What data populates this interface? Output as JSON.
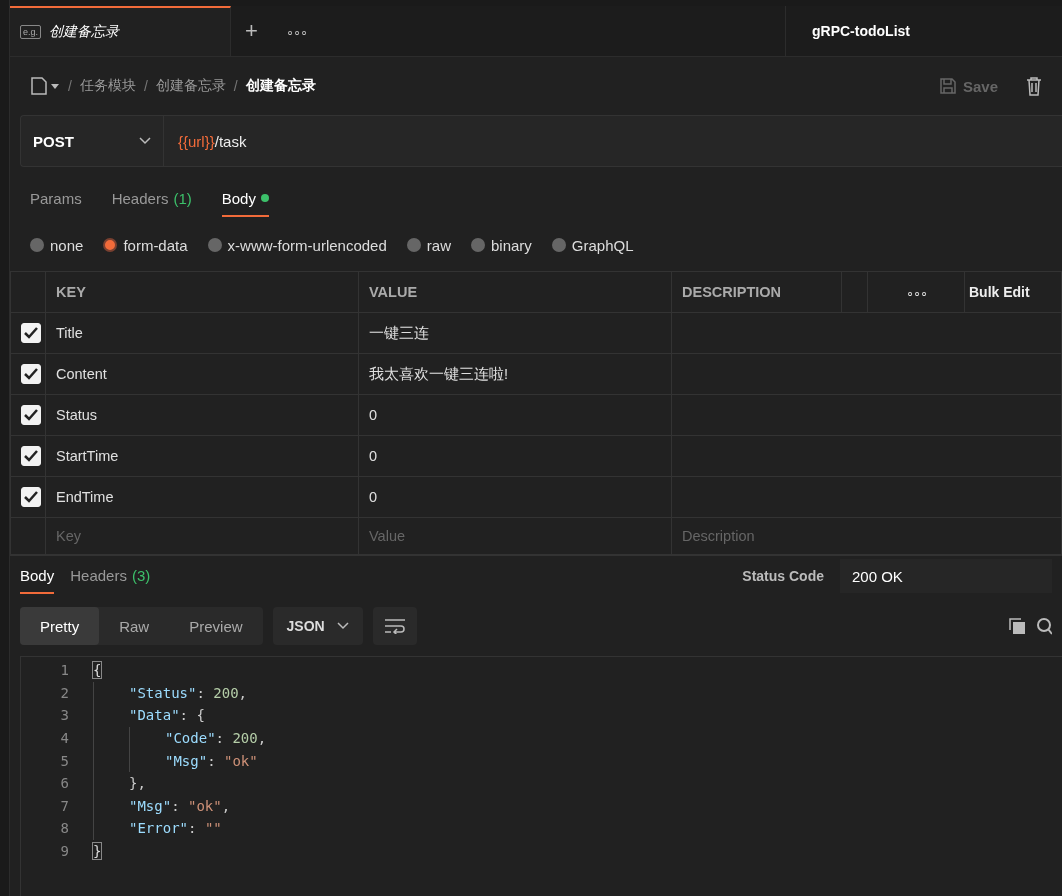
{
  "tabs": [
    {
      "badge": "e.g.",
      "label": "创建备忘录",
      "selected": true
    }
  ],
  "new_tab": "+",
  "more_tabs": "∘∘∘",
  "environment": "gRPC-todoList",
  "breadcrumb": [
    {
      "separator": "/",
      "label": "任务模块"
    },
    {
      "separator": "/",
      "label": "创建备忘录"
    },
    {
      "separator": "/",
      "label": "创建备忘录"
    }
  ],
  "save": {
    "label": "Save",
    "disabled": true
  },
  "request": {
    "method": "POST",
    "url_variable": "{{url}}",
    "url_path": "/task"
  },
  "request_tabs": [
    {
      "label": "Params",
      "selected": false
    },
    {
      "label": "Headers",
      "count": "(1)",
      "selected": false
    },
    {
      "label": "Body",
      "dot": true,
      "selected": true
    }
  ],
  "body_types": [
    {
      "label": "none",
      "selected": false
    },
    {
      "label": "form-data",
      "selected": true
    },
    {
      "label": "x-www-form-urlencoded",
      "selected": false
    },
    {
      "label": "raw",
      "selected": false
    },
    {
      "label": "binary",
      "selected": false
    },
    {
      "label": "GraphQL",
      "selected": false
    }
  ],
  "table": {
    "columns": [
      "KEY",
      "VALUE",
      "DESCRIPTION"
    ],
    "more": "∘∘∘",
    "bulk_edit": "Bulk Edit",
    "rows": [
      {
        "checked": true,
        "key": "Title",
        "value": "一键三连"
      },
      {
        "checked": true,
        "key": "Content",
        "value": "我太喜欢一键三连啦!"
      },
      {
        "checked": true,
        "key": "Status",
        "value": "0"
      },
      {
        "checked": true,
        "key": "StartTime",
        "value": "0"
      },
      {
        "checked": true,
        "key": "EndTime",
        "value": "0"
      }
    ],
    "new_row": {
      "key_placeholder": "Key",
      "value_placeholder": "Value",
      "description_placeholder": "Description"
    }
  },
  "response_tabs": [
    {
      "label": "Body",
      "selected": true
    },
    {
      "label": "Headers",
      "count": "(3)",
      "selected": false
    }
  ],
  "status_label": "Status Code",
  "status_value": "200 OK",
  "view_modes": [
    {
      "label": "Pretty",
      "selected": true
    },
    {
      "label": "Raw",
      "selected": false
    },
    {
      "label": "Preview",
      "selected": false
    }
  ],
  "format": "JSON",
  "code": [
    {
      "number": "1",
      "tokens": [
        {
          "kind": "bracket",
          "text": "{"
        }
      ]
    },
    {
      "number": "2",
      "tokens": [
        {
          "kind": "key",
          "text": "\"Status\""
        },
        {
          "kind": "punct",
          "text": ": "
        },
        {
          "kind": "number",
          "text": "200"
        },
        {
          "kind": "punct",
          "text": ","
        }
      ]
    },
    {
      "number": "3",
      "tokens": [
        {
          "kind": "key",
          "text": "\"Data\""
        },
        {
          "kind": "punct",
          "text": ": {"
        }
      ]
    },
    {
      "number": "4",
      "tokens": [
        {
          "kind": "key",
          "text": "\"Code\""
        },
        {
          "kind": "punct",
          "text": ": "
        },
        {
          "kind": "number",
          "text": "200"
        },
        {
          "kind": "punct",
          "text": ","
        }
      ]
    },
    {
      "number": "5",
      "tokens": [
        {
          "kind": "key",
          "text": "\"Msg\""
        },
        {
          "kind": "punct",
          "text": ": "
        },
        {
          "kind": "string",
          "text": "\"ok\""
        }
      ]
    },
    {
      "number": "6",
      "tokens": [
        {
          "kind": "punct",
          "text": "},"
        }
      ]
    },
    {
      "number": "7",
      "tokens": [
        {
          "kind": "key",
          "text": "\"Msg\""
        },
        {
          "kind": "punct",
          "text": ": "
        },
        {
          "kind": "string",
          "text": "\"ok\""
        },
        {
          "kind": "punct",
          "text": ","
        }
      ]
    },
    {
      "number": "8",
      "tokens": [
        {
          "kind": "key",
          "text": "\"Error\""
        },
        {
          "kind": "punct",
          "text": ": "
        },
        {
          "kind": "string",
          "text": "\"\""
        }
      ]
    },
    {
      "number": "9",
      "tokens": [
        {
          "kind": "bracket",
          "text": "}"
        }
      ]
    }
  ]
}
